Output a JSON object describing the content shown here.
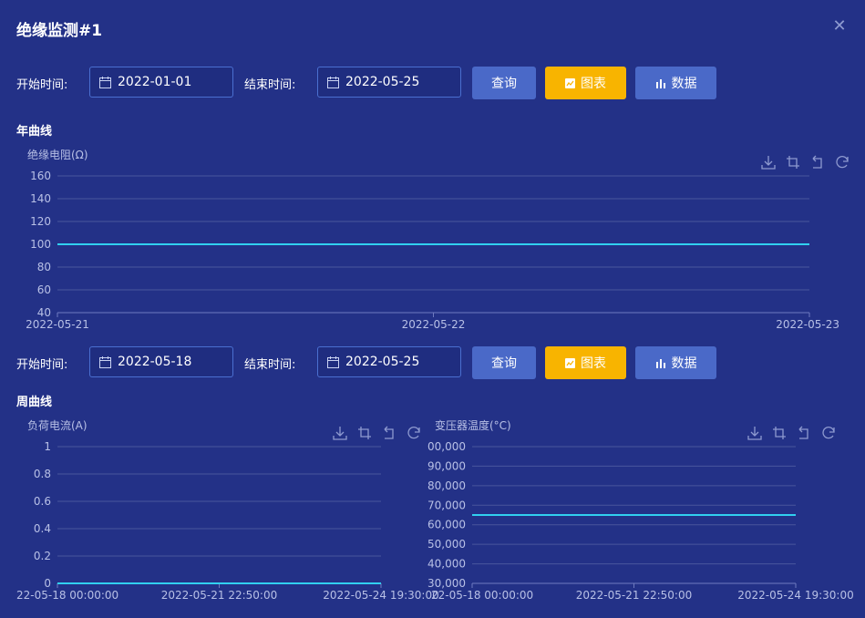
{
  "window": {
    "title": "绝缘监测#1",
    "close_icon": "close-icon"
  },
  "query1": {
    "start_label": "开始时间:",
    "start_value": "2022-01-01",
    "end_label": "结束时间:",
    "end_value": "2022-05-25",
    "query_label": "查询",
    "chart_label": "图表",
    "data_label": "数据"
  },
  "year_section": {
    "title": "年曲线"
  },
  "query2": {
    "start_label": "开始时间:",
    "start_value": "2022-05-18",
    "end_label": "结束时间:",
    "end_value": "2022-05-25",
    "query_label": "查询",
    "chart_label": "图表",
    "data_label": "数据"
  },
  "week_section": {
    "title": "周曲线"
  },
  "colors": {
    "background": "#233187",
    "accent_button": "#f8b400",
    "primary_button": "#4a69c8",
    "line": "#31d0f0",
    "grid": "#4a569c",
    "axis_text": "#b8c0e6"
  },
  "toolbar_icons": [
    "download-icon",
    "crop-icon",
    "undo-icon",
    "refresh-icon"
  ],
  "chart_data": [
    {
      "type": "line",
      "title": "",
      "ylabel": "绝缘电阻(Ω)",
      "xlabel": "",
      "x": [
        "2022-05-21",
        "2022-05-22",
        "2022-05-23"
      ],
      "y_ticks": [
        "160",
        "140",
        "120",
        "100",
        "80",
        "60",
        "40"
      ],
      "ylim": [
        40,
        160
      ],
      "series": [
        {
          "values": [
            100,
            100,
            100
          ]
        }
      ],
      "grid": true
    },
    {
      "type": "line",
      "title": "",
      "ylabel": "负荷电流(A)",
      "xlabel": "",
      "x": [
        "22-05-18 00:00:00",
        "2022-05-21 22:50:00",
        "2022-05-24 19:30:00"
      ],
      "y_ticks": [
        "1",
        "0.8",
        "0.6",
        "0.4",
        "0.2",
        "0"
      ],
      "ylim": [
        0,
        1
      ],
      "series": [
        {
          "values": [
            0,
            0,
            0
          ]
        }
      ],
      "grid": true
    },
    {
      "type": "line",
      "title": "",
      "ylabel": "变压器温度(°C)",
      "xlabel": "",
      "x": [
        "22-05-18 00:00:00",
        "2022-05-21 22:50:00",
        "2022-05-24 19:30:00"
      ],
      "y_ticks": [
        "00,000",
        "90,000",
        "80,000",
        "70,000",
        "60,000",
        "50,000",
        "40,000",
        "30,000"
      ],
      "ylim": [
        30000,
        100000
      ],
      "series": [
        {
          "values": [
            65000,
            65000,
            65000
          ]
        }
      ],
      "grid": true
    }
  ]
}
